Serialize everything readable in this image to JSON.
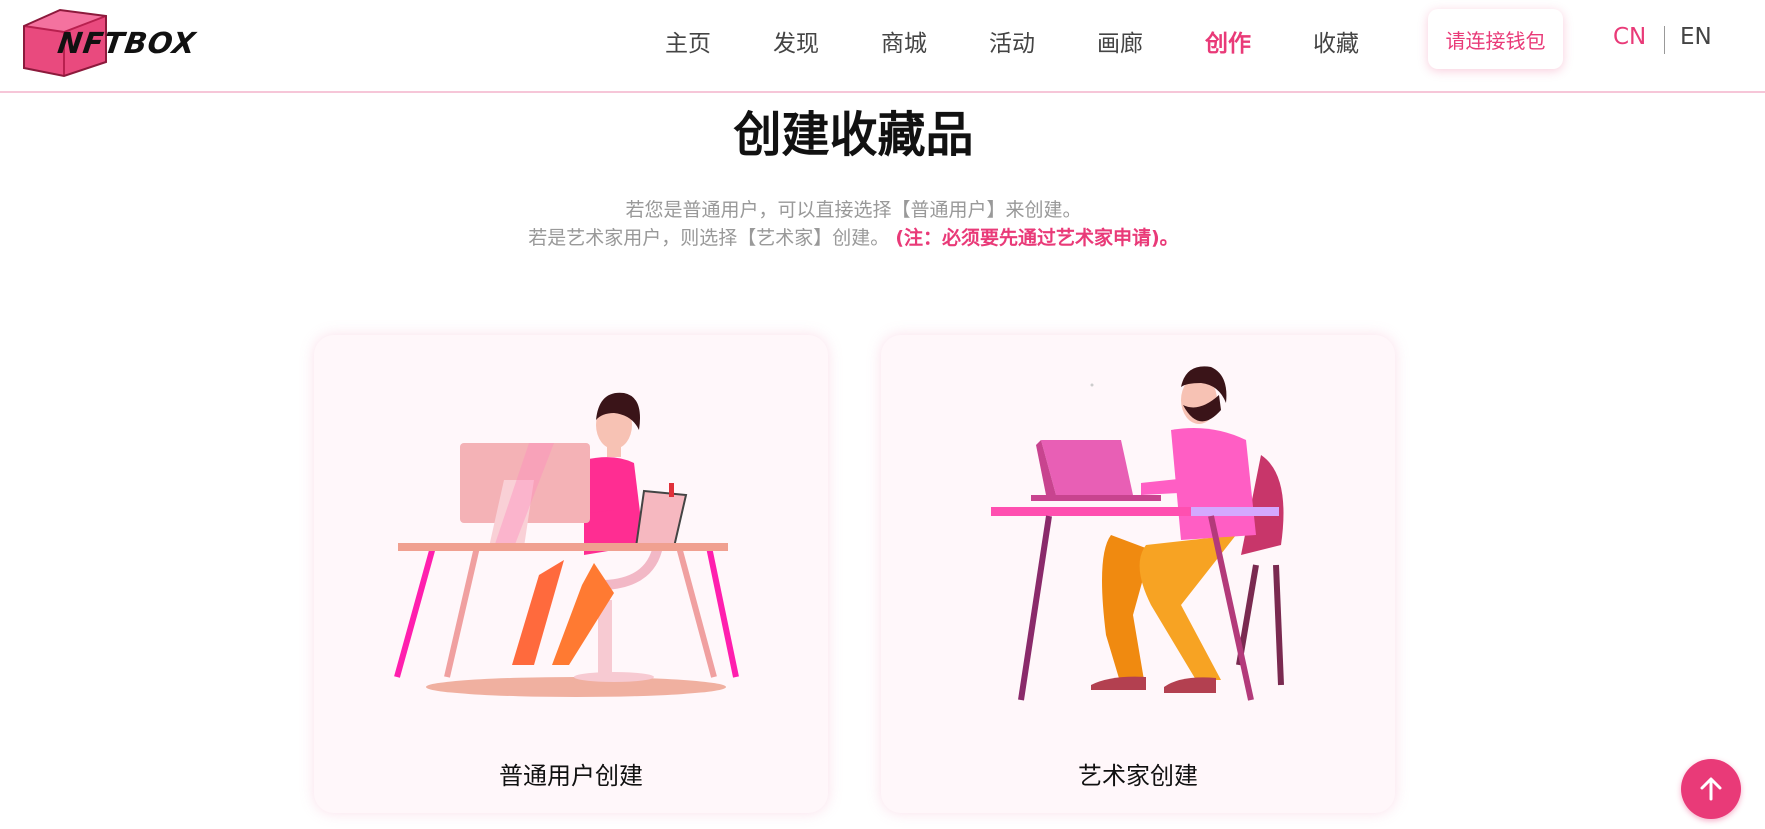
{
  "header": {
    "logo_text": "NFTBOX",
    "nav": [
      "主页",
      "发现",
      "商城",
      "活动",
      "画廊",
      "创作",
      "收藏"
    ],
    "active_nav": "创作",
    "wallet_button": "请连接钱包",
    "lang_cn": "CN",
    "lang_en": "EN"
  },
  "main": {
    "title": "创建收藏品",
    "desc_line1": "若您是普通用户，可以直接选择【普通用户】来创建。",
    "desc_line2": "若是艺术家用户，则选择【艺术家】创建。",
    "desc_note": "(注：必须要先通过艺术家申请)。",
    "cards": [
      {
        "label": "普通用户创建",
        "icon": "person-at-desktop-illustration"
      },
      {
        "label": "艺术家创建",
        "icon": "person-at-laptop-illustration"
      }
    ]
  },
  "back_to_top": {
    "icon": "arrow-up-icon"
  },
  "colors": {
    "accent": "#e93a78",
    "header_border": "#f6c6d8",
    "card_bg": "#fff7fa",
    "text_muted": "#999999"
  }
}
